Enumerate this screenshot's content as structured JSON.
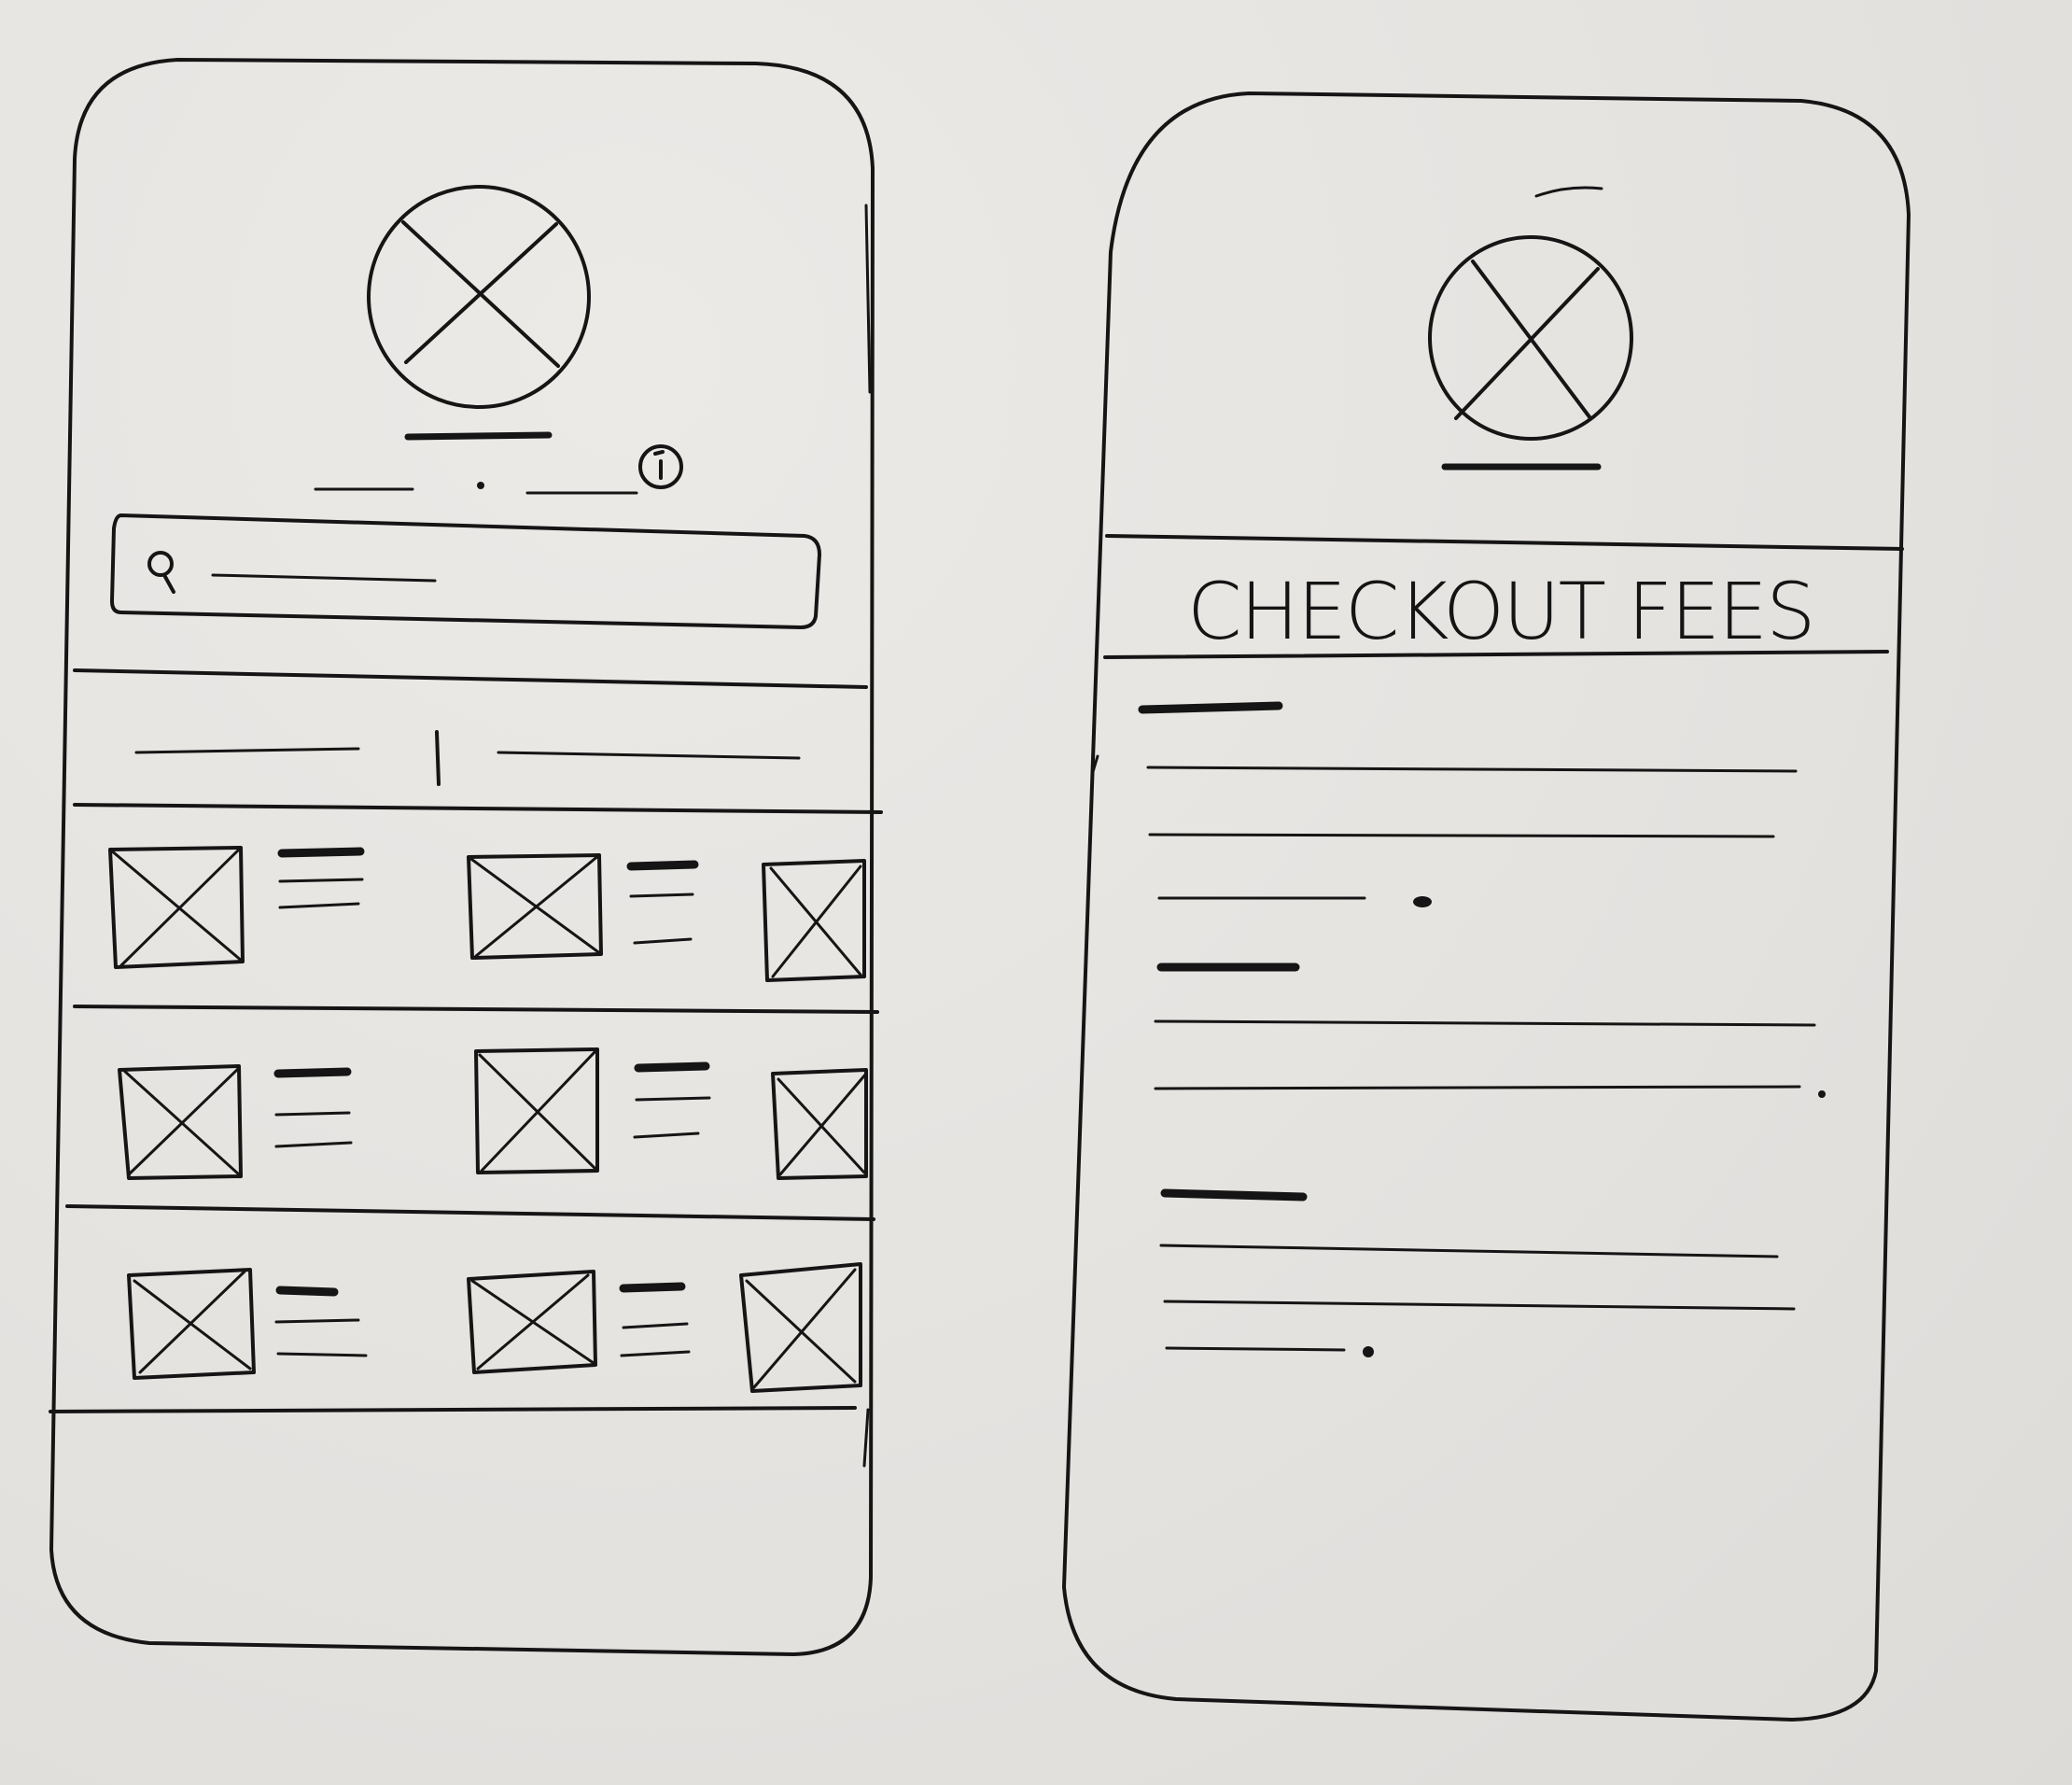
{
  "checkout_screen": {
    "header_title": "CHECKOUT FEES"
  }
}
